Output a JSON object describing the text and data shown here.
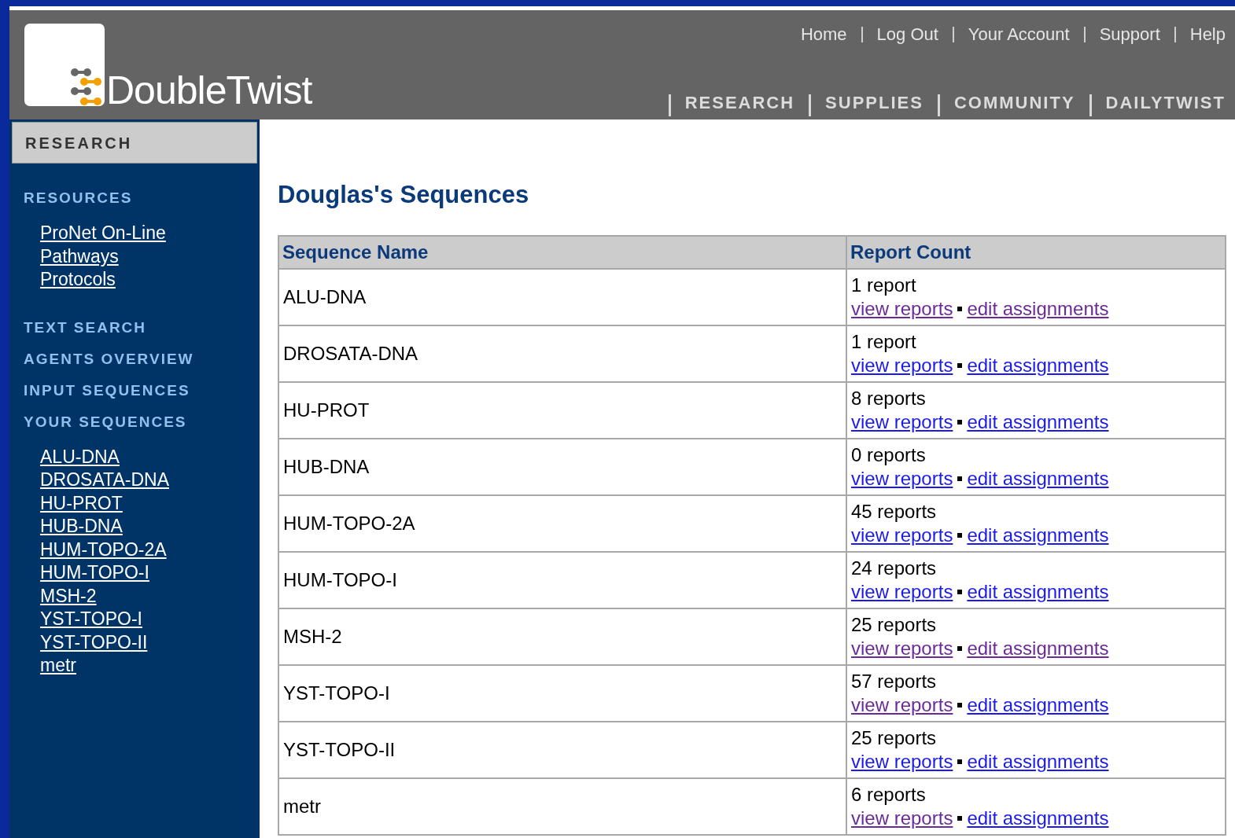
{
  "logo": {
    "text": "DoubleTwist"
  },
  "top_links": [
    {
      "label": "Home"
    },
    {
      "label": "Log Out"
    },
    {
      "label": "Your Account"
    },
    {
      "label": "Support"
    },
    {
      "label": "Help"
    }
  ],
  "main_nav": [
    {
      "label": "RESEARCH"
    },
    {
      "label": "SUPPLIES"
    },
    {
      "label": "COMMUNITY"
    },
    {
      "label": "DAILYTWIST"
    }
  ],
  "sidebar": {
    "section_tab": "RESEARCH",
    "groups": [
      {
        "heading": "RESOURCES",
        "items": [
          {
            "label": "ProNet On-Line"
          },
          {
            "label": "Pathways"
          },
          {
            "label": "Protocols"
          }
        ]
      },
      {
        "heading": "TEXT SEARCH"
      },
      {
        "heading": "AGENTS OVERVIEW"
      },
      {
        "heading": "INPUT SEQUENCES"
      },
      {
        "heading": "YOUR SEQUENCES",
        "items": [
          {
            "label": "ALU-DNA"
          },
          {
            "label": "DROSATA-DNA"
          },
          {
            "label": "HU-PROT"
          },
          {
            "label": "HUB-DNA"
          },
          {
            "label": "HUM-TOPO-2A"
          },
          {
            "label": "HUM-TOPO-I"
          },
          {
            "label": "MSH-2"
          },
          {
            "label": "YST-TOPO-I"
          },
          {
            "label": "YST-TOPO-II"
          },
          {
            "label": "metr"
          }
        ]
      }
    ]
  },
  "page_title": "Douglas's Sequences",
  "table": {
    "columns": [
      "Sequence Name",
      "Report Count"
    ],
    "rows": [
      {
        "name": "ALU-DNA",
        "count": "1 report",
        "view": {
          "label": "view reports",
          "visited": true
        },
        "edit": {
          "label": "edit assignments",
          "visited": true
        }
      },
      {
        "name": "DROSATA-DNA",
        "count": "1 report",
        "view": {
          "label": "view reports",
          "visited": false
        },
        "edit": {
          "label": "edit assignments",
          "visited": false
        }
      },
      {
        "name": "HU-PROT",
        "count": "8 reports",
        "view": {
          "label": "view reports",
          "visited": false
        },
        "edit": {
          "label": "edit assignments",
          "visited": false
        }
      },
      {
        "name": "HUB-DNA",
        "count": "0 reports",
        "view": {
          "label": "view reports",
          "visited": false
        },
        "edit": {
          "label": "edit assignments",
          "visited": false
        }
      },
      {
        "name": "HUM-TOPO-2A",
        "count": "45 reports",
        "view": {
          "label": "view reports",
          "visited": false
        },
        "edit": {
          "label": "edit assignments",
          "visited": false
        }
      },
      {
        "name": "HUM-TOPO-I",
        "count": "24 reports",
        "view": {
          "label": "view reports",
          "visited": false
        },
        "edit": {
          "label": "edit assignments",
          "visited": false
        }
      },
      {
        "name": "MSH-2",
        "count": "25 reports",
        "view": {
          "label": "view reports",
          "visited": true
        },
        "edit": {
          "label": "edit assignments",
          "visited": true
        }
      },
      {
        "name": "YST-TOPO-I",
        "count": "57 reports",
        "view": {
          "label": "view reports",
          "visited": true
        },
        "edit": {
          "label": "edit assignments",
          "visited": false
        }
      },
      {
        "name": "YST-TOPO-II",
        "count": "25 reports",
        "view": {
          "label": "view reports",
          "visited": false
        },
        "edit": {
          "label": "edit assignments",
          "visited": false
        }
      },
      {
        "name": "metr",
        "count": "6 reports",
        "view": {
          "label": "view reports",
          "visited": true
        },
        "edit": {
          "label": "edit assignments",
          "visited": false
        }
      }
    ]
  }
}
